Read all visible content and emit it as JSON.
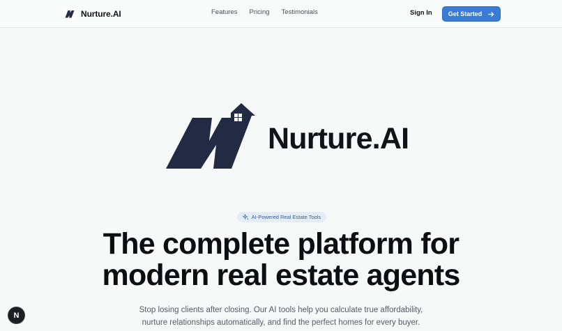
{
  "header": {
    "brand_name": "Nurture.AI",
    "nav": [
      "Features",
      "Pricing",
      "Testimonials"
    ],
    "sign_in": "Sign In",
    "cta_label": "Get Started",
    "cta_icon": "arrow-right-icon"
  },
  "hero": {
    "logo_text": "Nurture.AI",
    "badge": "AI-Powered Real Estate Tools",
    "headline_line1": "The complete platform for",
    "headline_line2": "modern real estate agents",
    "subtext_line1": "Stop losing clients after closing. Our AI tools help you calculate true affordability,",
    "subtext_line2": "nurture relationships automatically, and find the perfect homes for every buyer."
  },
  "fab": {
    "label": "N"
  },
  "colors": {
    "accent": "#3a7bd5",
    "logo_navy": "#232a44",
    "background": "#f7f8f8"
  }
}
